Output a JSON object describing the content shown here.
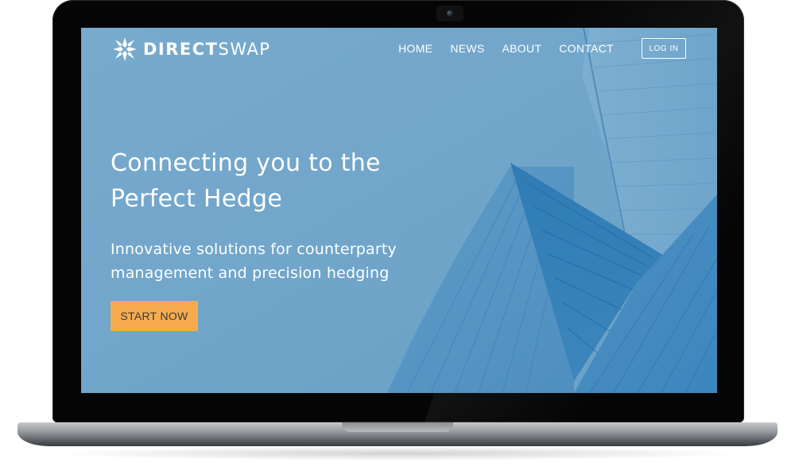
{
  "brand": {
    "name_bold": "DIRECT",
    "name_light": "SWAP",
    "logo_icon": "star-burst-icon"
  },
  "nav": {
    "items": [
      {
        "label": "HOME"
      },
      {
        "label": "NEWS"
      },
      {
        "label": "ABOUT"
      },
      {
        "label": "CONTACT"
      }
    ],
    "login_label": "LOG IN"
  },
  "hero": {
    "title_line1": "Connecting you to the",
    "title_line2": "Perfect Hedge",
    "subtitle_line1": "Innovative solutions for counterparty",
    "subtitle_line2": "management and precision hedging",
    "cta_label": "START NOW"
  },
  "colors": {
    "screen_background": "#6fa4c8",
    "building_dark": "#2f7cb6",
    "building_mid": "#4a8fc2",
    "cta_background": "#f6ac4d",
    "device_frame": "#050505",
    "device_base": "#9c9fa3"
  }
}
